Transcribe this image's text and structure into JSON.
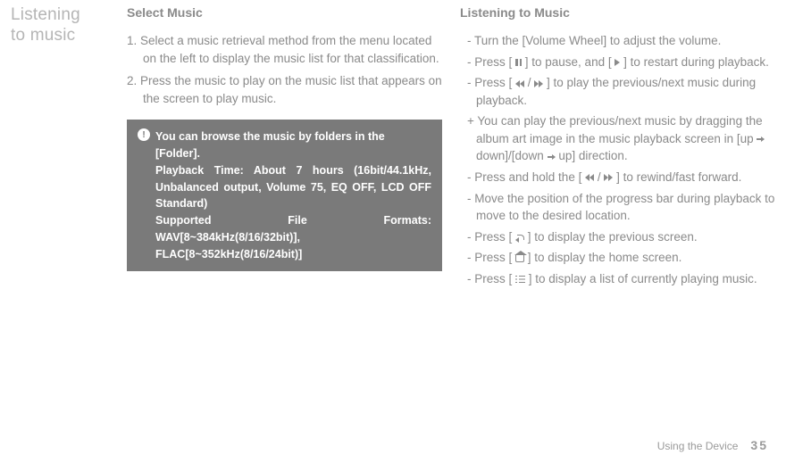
{
  "side_title_line1": "Listening",
  "side_title_line2": "to music",
  "left": {
    "heading": "Select Music",
    "step1": "1. Select a music retrieval method from the menu located on the left to display the music list for that classification.",
    "step2": "2. Press the music to play on the music list that appears on the screen to play music.",
    "info_line1": "You can browse the music by folders in the [Folder].",
    "info_line2": "Playback Time: About 7 hours (16bit/44.1kHz, Unbalanced output, Volume 75, EQ OFF, LCD OFF Standard)",
    "info_line3": "Supported File Formats: WAV[8~384kHz(8/16/32bit)], FLAC[8~352kHz(8/16/24bit)]"
  },
  "right": {
    "heading": "Listening to Music",
    "b1": "- Turn the [Volume Wheel] to adjust the volume.",
    "b2a": "- Press [ ",
    "b2b": " ] to pause, and [ ",
    "b2c": " ] to restart during playback.",
    "b3a": "- Press [ ",
    "b3b": " / ",
    "b3c": " ] to play the previous/next music during playback.",
    "b4a": " + You can play the previous/next music by dragging the album art image in the music playback screen in [up ",
    "b4b": " down]/[down ",
    "b4c": " up] direction.",
    "b5a": "- Press and hold the [ ",
    "b5b": " / ",
    "b5c": " ] to rewind/fast forward.",
    "b6": "- Move the position of the progress bar during playback to move to the desired location.",
    "b7a": "- Press [ ",
    "b7b": " ] to display the previous screen.",
    "b8a": "- Press [ ",
    "b8b": " ] to display the home screen.",
    "b9a": "- Press [ ",
    "b9b": " ] to display a list of currently playing music."
  },
  "footer": {
    "label": "Using the Device",
    "page": "35"
  }
}
